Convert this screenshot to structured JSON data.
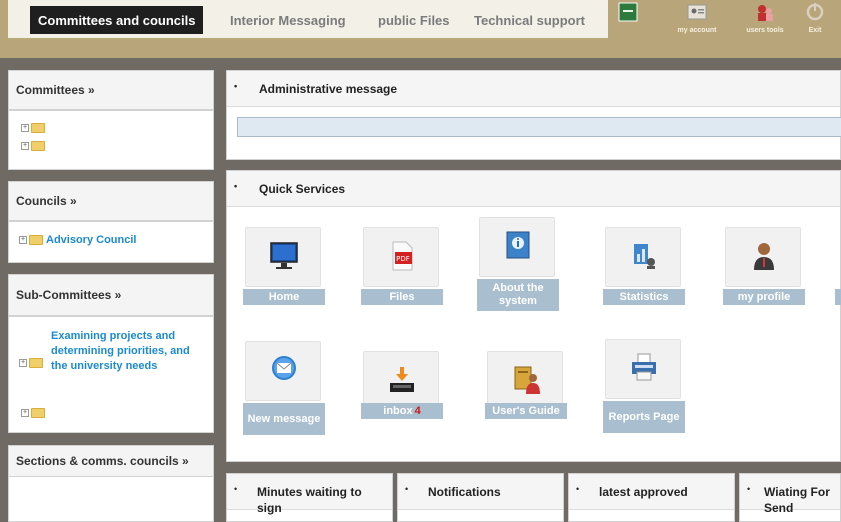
{
  "nav": {
    "active": "Committees and councils",
    "items": [
      "Interior Messaging",
      "public Files",
      "Technical support"
    ]
  },
  "toolbar": {
    "account_label": "my account",
    "users_label": "users tools",
    "exit_label": "Exit"
  },
  "sidebar": {
    "committees_title": "Committees »",
    "councils_title": "Councils »",
    "councils_item": "Advisory Council",
    "subcommittees_title": "Sub-Committees »",
    "subcommittees_item": "Examining projects and determining priorities, and the university needs",
    "sections_title": "Sections & comms. councils »"
  },
  "admin_panel": {
    "title": "Administrative message"
  },
  "quick_panel": {
    "title": "Quick Services",
    "tiles": [
      {
        "label": "Home",
        "icon": "monitor-icon"
      },
      {
        "label": "Files",
        "icon": "pdf-icon"
      },
      {
        "label": "About the system",
        "icon": "info-icon"
      },
      {
        "label": "Statistics",
        "icon": "statistics-icon"
      },
      {
        "label": "my profile",
        "icon": "profile-icon"
      },
      {
        "label": "New message",
        "icon": "mail-icon"
      },
      {
        "label": "inbox",
        "badge": "4",
        "icon": "inbox-icon"
      },
      {
        "label": "User's Guide",
        "icon": "guide-icon"
      },
      {
        "label": "Reports Page",
        "icon": "printer-icon"
      }
    ]
  },
  "bottom_panels": [
    "Minutes waiting to sign",
    "Notifications",
    "latest approved",
    "Wiating For Send"
  ],
  "colors": {
    "accent": "#1c8ad0",
    "tile_label": "#a9bfcf",
    "banner": "#b8a57a",
    "background": "#6f6a63",
    "badge": "#d01818"
  }
}
